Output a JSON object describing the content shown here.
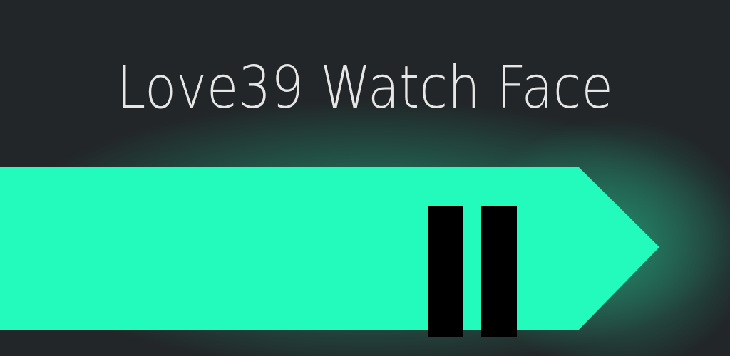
{
  "banner": {
    "title": "Love39 Watch Face"
  },
  "colors": {
    "background": "#222628",
    "accent": "#22fbbb",
    "title_text": "#e6e6e6",
    "pause_bars": "#000000"
  },
  "icons": {
    "pause": "pause-icon",
    "arrow": "arrow-shape"
  }
}
